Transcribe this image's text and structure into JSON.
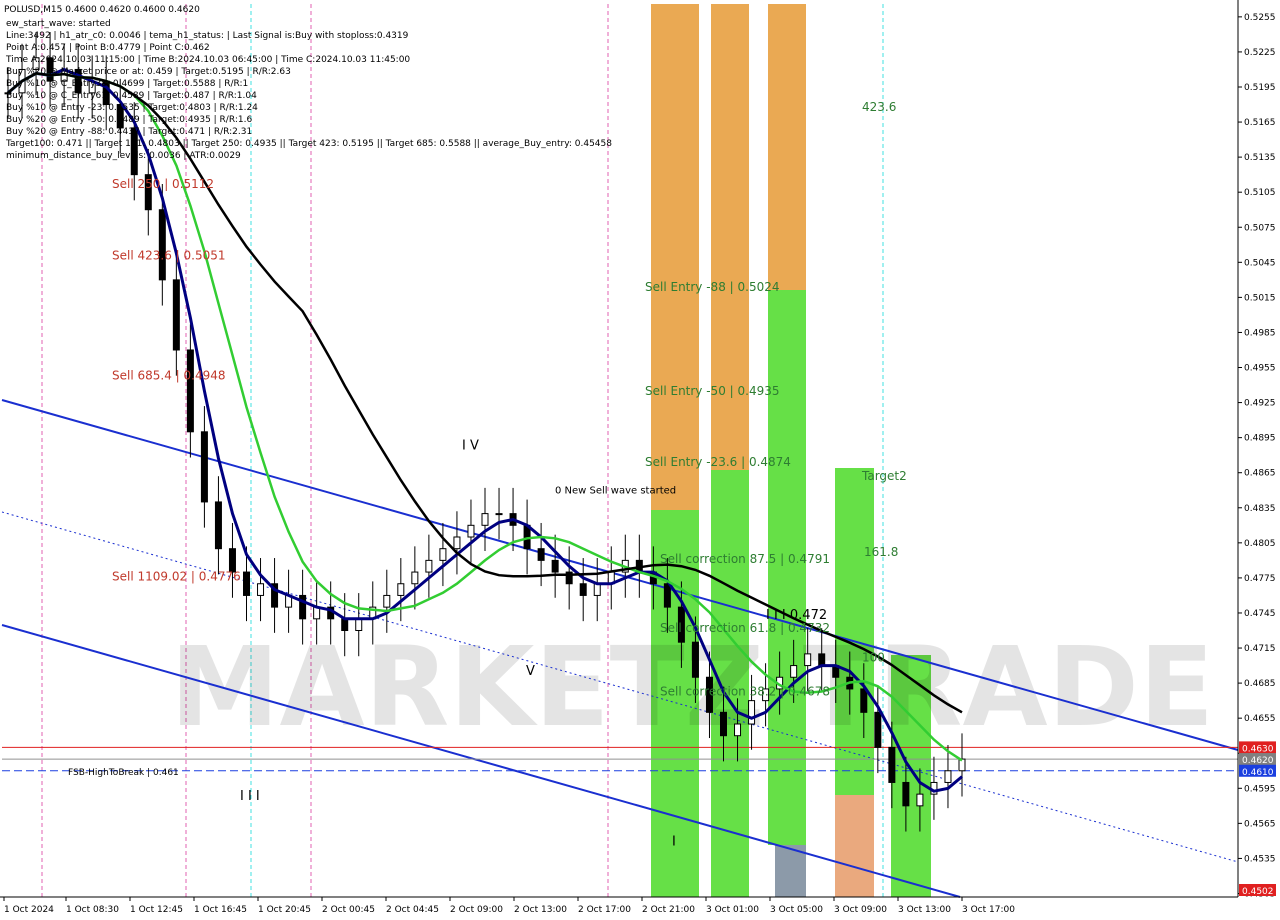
{
  "chart_data": {
    "type": "candlestick",
    "symbol_line": "POLUSD,M15 0.4600 0.4620 0.4600 0.4620",
    "info_lines": [
      "ew_start_wave: started",
      "Line:3492 | h1_atr_c0: 0.0046 | tema_h1_status: | Last Signal is:Buy with stoploss:0.4319",
      "Point A:0.457 | Point B:0.4779 | Point C:0.462",
      "Time A:2024.10.03 11:15:00 | Time B:2024.10.03 06:45:00 | Time C:2024.10.03 11:45:00",
      "Buy %20 @ Market price or at: 0.459 | Target:0.5195 | R/R:2.63",
      "Buy %10 @ C_Entry38: 0.4699 | Target:0.5588 | R/R:1",
      "Buy %10 @ C_Entry61: 0.4589 | Target:0.487 | R/R:1.04",
      "Buy %10 @ Entry -23: 0.4535 | Target:0.4803 | R/R:1.24",
      "Buy %20 @ Entry -50: 0.4489 | Target:0.4935 | R/R:1.6",
      "Buy %20 @ Entry -88: 0.4437 | Target:0.471 | R/R:2.31",
      "Target100: 0.471 || Target 161: 0.4803 || Target 250: 0.4935 || Target 423: 0.5195 || Target 685: 0.5588 || average_Buy_entry: 0.45458",
      "minimum_distance_buy_levels: 0.0036 | ATR:0.0029"
    ],
    "ylim": [
      0.4502,
      0.5266
    ],
    "y_ticks": [
      "0.5255",
      "0.5225",
      "0.5195",
      "0.5165",
      "0.5135",
      "0.5105",
      "0.5075",
      "0.5045",
      "0.5015",
      "0.4985",
      "0.4955",
      "0.4925",
      "0.4895",
      "0.4865",
      "0.4835",
      "0.4805",
      "0.4775",
      "0.4745",
      "0.4715",
      "0.4685",
      "0.4655",
      "0.4625",
      "0.4595",
      "0.4565",
      "0.4535",
      "0.4505"
    ],
    "x_ticks": [
      "1 Oct 2024",
      "1 Oct 08:30",
      "1 Oct 12:45",
      "1 Oct 16:45",
      "1 Oct 20:45",
      "2 Oct 00:45",
      "2 Oct 04:45",
      "2 Oct 09:00",
      "2 Oct 13:00",
      "2 Oct 17:00",
      "2 Oct 21:00",
      "3 Oct 01:00",
      "3 Oct 05:00",
      "3 Oct 09:00",
      "3 Oct 13:00",
      "3 Oct 17:00"
    ],
    "price_tags": [
      {
        "label": "0.4630",
        "value": 0.463,
        "color": "#e02020"
      },
      {
        "label": "0.4620",
        "value": 0.462,
        "color": "#808080"
      },
      {
        "label": "0.4610",
        "value": 0.461,
        "color": "#1a3fe0"
      },
      {
        "label": "0.4502",
        "value": 0.4502,
        "color": "#e02020"
      }
    ],
    "level_labels": [
      {
        "text": "Sell 250 | 0.5112",
        "value": 0.5112,
        "x_index": 0,
        "color": "red"
      },
      {
        "text": "Sell 423.6 | 0.5051",
        "value": 0.5051,
        "x_index": 0,
        "color": "red"
      },
      {
        "text": "Sell 685.4 | 0.4948",
        "value": 0.4948,
        "x_index": 0,
        "color": "red"
      },
      {
        "text": "Sell 1109.02 | 0.4776",
        "value": 0.4776,
        "x_index": 0,
        "color": "red"
      },
      {
        "text": "FSB-HighToBreak | 0.461",
        "value": 0.461,
        "x_index": 1,
        "color": "dark"
      },
      {
        "text": "Sell Entry -88 | 0.5024",
        "value": 0.5024,
        "x_index": 2,
        "color": "green"
      },
      {
        "text": "Sell Entry -50 | 0.4935",
        "value": 0.4935,
        "x_index": 2,
        "color": "green"
      },
      {
        "text": "Sell Entry -23.6 | 0.4874",
        "value": 0.4874,
        "x_index": 2,
        "color": "green"
      },
      {
        "text": "Sell correction 87.5 | 0.4791",
        "value": 0.4791,
        "x_index": 3,
        "color": "green"
      },
      {
        "text": "Sell correction 61.8 | 0.4732",
        "value": 0.4732,
        "x_index": 3,
        "color": "green"
      },
      {
        "text": "Sell correction 38.2 | 0.4678",
        "value": 0.4678,
        "x_index": 3,
        "color": "green"
      },
      {
        "text": "423.6",
        "value": 0.5178,
        "x_index": 4,
        "color": "green"
      },
      {
        "text": "Target2",
        "value": 0.4862,
        "x_index": 5,
        "color": "green"
      },
      {
        "text": "161.8",
        "value": 0.4797,
        "x_index": 5,
        "color": "green"
      },
      {
        "text": "100",
        "value": 0.4707,
        "x_index": 5,
        "color": "green"
      }
    ],
    "wave_labels": [
      {
        "text": "I V",
        "value": 0.4885
      },
      {
        "text": "0 New Sell wave started",
        "value": 0.4847
      },
      {
        "text": "V",
        "value": 0.4692
      },
      {
        "text": "I I I 0.472",
        "value": 0.474
      },
      {
        "text": "I I I",
        "value": 0.4585
      },
      {
        "text": "I",
        "value": 0.4546
      }
    ],
    "watermark": "MARKETZ TRADE",
    "series": [
      {
        "name": "price",
        "type": "candles",
        "color": "#000000",
        "close": [
          0.519,
          0.521,
          0.522,
          0.52,
          0.521,
          0.519,
          0.52,
          0.518,
          0.516,
          0.512,
          0.509,
          0.503,
          0.497,
          0.49,
          0.484,
          0.48,
          0.478,
          0.476,
          0.477,
          0.475,
          0.476,
          0.474,
          0.475,
          0.474,
          0.473,
          0.474,
          0.475,
          0.476,
          0.477,
          0.478,
          0.479,
          0.48,
          0.481,
          0.482,
          0.483,
          0.483,
          0.482,
          0.48,
          0.479,
          0.478,
          0.477,
          0.476,
          0.477,
          0.478,
          0.479,
          0.478,
          0.477,
          0.475,
          0.472,
          0.469,
          0.466,
          0.464,
          0.465,
          0.467,
          0.468,
          0.469,
          0.47,
          0.471,
          0.47,
          0.469,
          0.468,
          0.466,
          0.463,
          0.46,
          0.458,
          0.459,
          0.46,
          0.461,
          0.462
        ]
      },
      {
        "name": "ma_fast",
        "color": "#000080"
      },
      {
        "name": "ma_mid",
        "color": "#32cd32"
      },
      {
        "name": "ma_slow",
        "color": "#000000"
      }
    ]
  }
}
